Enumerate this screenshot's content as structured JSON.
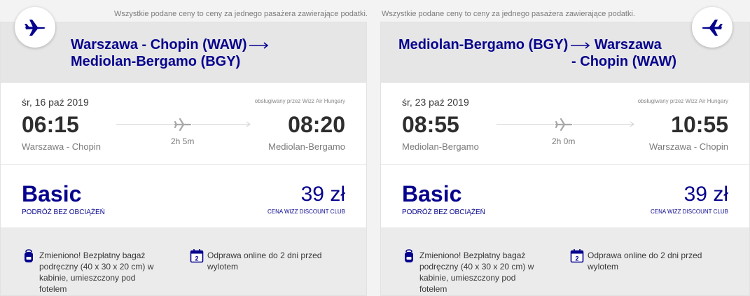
{
  "notice": "Wszystkie podane ceny to ceny za jednego pasażera zawierające podatki.",
  "colors": {
    "brand": "#06038d",
    "text": "#3a3a3a",
    "muted": "#7a7a7a"
  },
  "outbound": {
    "route_from": "Warszawa - Chopin (WAW)",
    "route_to": "Mediolan-Bergamo (BGY)",
    "icon": "plane-departure-icon",
    "date": "śr, 16 paź 2019",
    "operator": "obsługiwany przez Wizz Air Hungary",
    "dep_time": "06:15",
    "arr_time": "08:20",
    "dep_city": "Warszawa - Chopin",
    "arr_city": "Mediolan-Bergamo",
    "duration": "2h 5m",
    "fare_name": "Basic",
    "fare_sub": "PODRÓŻ BEZ OBCIĄŻEŃ",
    "price": "39 zł",
    "price_note": "CENA WIZZ DISCOUNT CLUB",
    "bag_text": "Zmieniono! Bezpłatny bagaż podręczny (40 x 30 x 20 cm) w kabinie, umieszczony pod fotelem",
    "checkin_text": "Odprawa online do 2 dni przed wylotem",
    "checkin_badge": "2"
  },
  "inbound": {
    "route_from": "Mediolan-Bergamo (BGY)",
    "route_to_line1": "Warszawa",
    "route_to_line2": "- Chopin (WAW)",
    "icon": "plane-return-icon",
    "date": "śr, 23 paź 2019",
    "operator": "obsługiwany przez Wizz Air Hungary",
    "dep_time": "08:55",
    "arr_time": "10:55",
    "dep_city": "Mediolan-Bergamo",
    "arr_city": "Warszawa - Chopin",
    "duration": "2h 0m",
    "fare_name": "Basic",
    "fare_sub": "PODRÓŻ BEZ OBCIĄŻEŃ",
    "price": "39 zł",
    "price_note": "CENA WIZZ DISCOUNT CLUB",
    "bag_text": "Zmieniono! Bezpłatny bagaż podręczny (40 x 30 x 20 cm) w kabinie, umieszczony pod fotelem",
    "checkin_text": "Odprawa online do 2 dni przed wylotem",
    "checkin_badge": "2"
  }
}
